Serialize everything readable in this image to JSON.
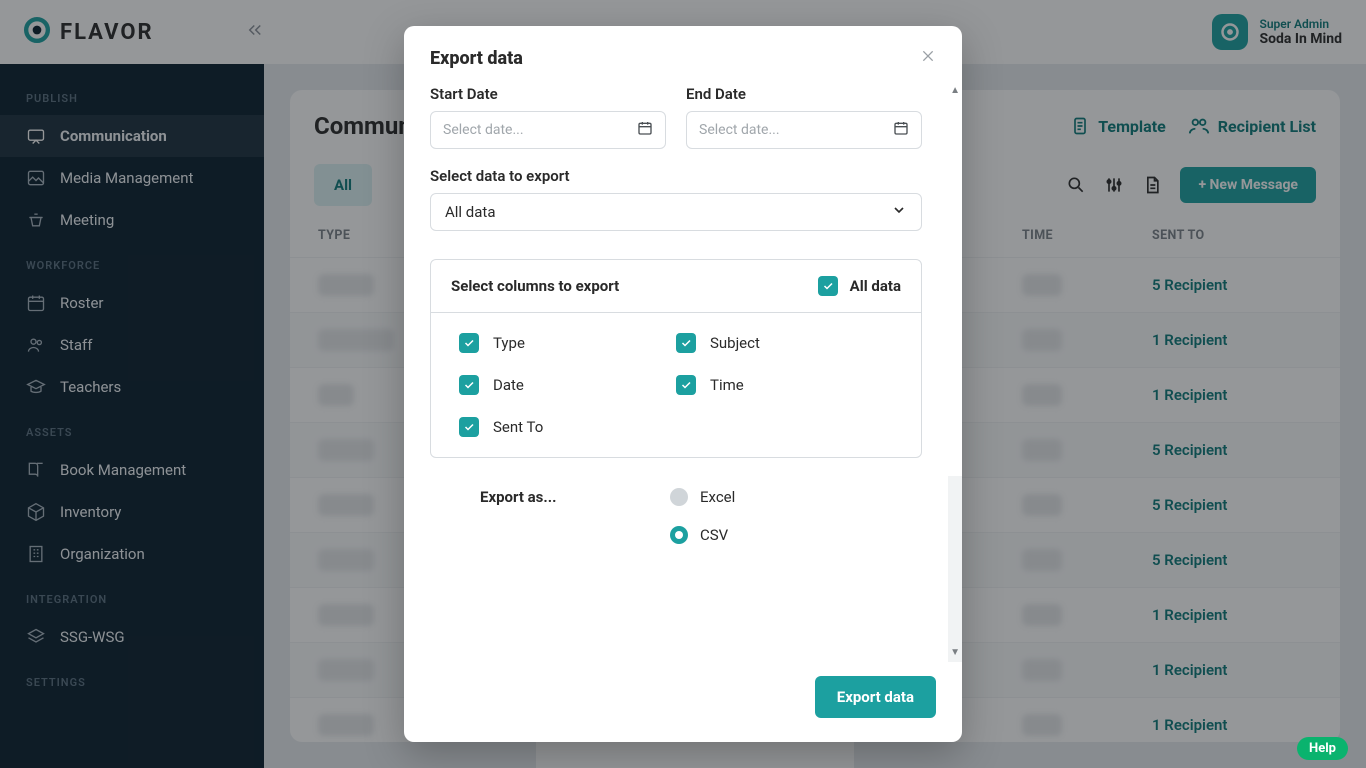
{
  "brand": {
    "name": "FLAVOR"
  },
  "user": {
    "role": "Super Admin",
    "org": "Soda In Mind"
  },
  "sidebar": {
    "sections": {
      "publish": "Publish",
      "workforce": "Workforce",
      "assets": "Assets",
      "integration": "Integration",
      "settings": "Settings"
    },
    "communication": "Communication",
    "media": "Media Management",
    "meeting": "Meeting",
    "roster": "Roster",
    "staff": "Staff",
    "teachers": "Teachers",
    "book": "Book Management",
    "inventory": "Inventory",
    "organization": "Organization",
    "ssg": "SSG-WSG"
  },
  "page": {
    "title": "Communication",
    "template_link": "Template",
    "recipient_link": "Recipient List",
    "tab_all": "All",
    "new_msg": "+ New Message",
    "columns": {
      "type": "Type",
      "time": "Time",
      "sent_to": "Sent To"
    },
    "rows": [
      {
        "sent": "5 Recipient"
      },
      {
        "sent": "1 Recipient"
      },
      {
        "sent": "1 Recipient"
      },
      {
        "sent": "5 Recipient"
      },
      {
        "sent": "5 Recipient"
      },
      {
        "sent": "5 Recipient"
      },
      {
        "sent": "1 Recipient"
      },
      {
        "sent": "1 Recipient"
      },
      {
        "sent": "1 Recipient"
      }
    ]
  },
  "modal": {
    "title": "Export data",
    "start_date": "Start Date",
    "end_date": "End Date",
    "date_placeholder": "Select date...",
    "select_data_label": "Select data to export",
    "select_data_value": "All data",
    "select_columns_title": "Select columns to export",
    "all_data_check": "All data",
    "col_checks": {
      "type": "Type",
      "subject": "Subject",
      "date": "Date",
      "time": "Time",
      "sent_to": "Sent To"
    },
    "export_as": "Export as...",
    "excel": "Excel",
    "csv": "CSV",
    "export_btn": "Export data"
  },
  "help": "Help"
}
